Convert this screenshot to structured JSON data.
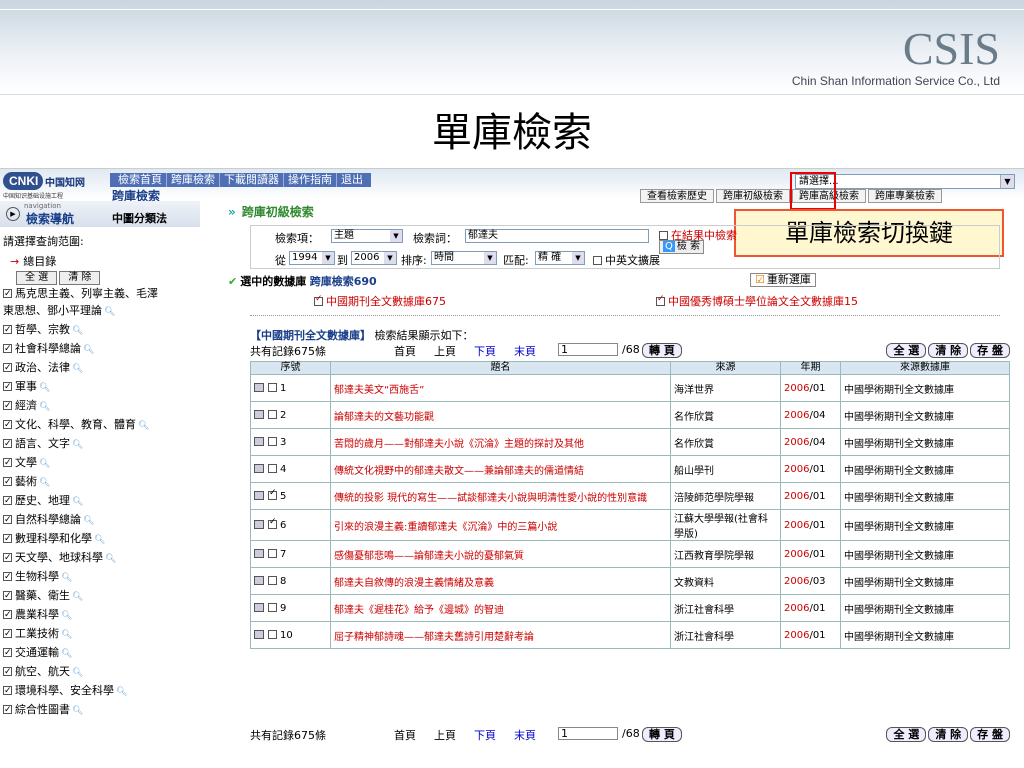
{
  "banner": {
    "brand": "CSIS",
    "company": "Chin Shan Information Service Co., Ltd"
  },
  "slide_title": "單庫檢索",
  "app": {
    "logo_cnki": "CNKI",
    "logo_zh": "中国知网",
    "logo_small": "中国知识基础设施工程",
    "topnav": [
      "檢索首頁",
      "跨庫檢索",
      "下載閱讀器",
      "操作指南",
      "退出"
    ],
    "page_sub": "跨庫檢索",
    "db_select": "請選擇...",
    "tabs": [
      "查看檢索歷史",
      "跨庫初級檢索",
      "跨庫高級檢索",
      "跨庫專業檢索"
    ],
    "callout": "單庫檢索切換鍵"
  },
  "sidebar": {
    "nav_tiny": "navigation",
    "nav_title": "檢索導航",
    "classify": "中圖分類法",
    "range_label": "請選擇查詢范圍:",
    "all_dir": "總目錄",
    "btn_all": "全 選",
    "btn_clear": "清 除",
    "categories": [
      {
        "label": "馬克思主義、列寧主義、毛澤",
        "mag": false
      },
      {
        "label": "東思想、鄧小平理論",
        "mag": true,
        "nobox": true
      },
      {
        "label": "哲學、宗教",
        "mag": true
      },
      {
        "label": "社會科學總論",
        "mag": true
      },
      {
        "label": "政治、法律",
        "mag": true
      },
      {
        "label": "軍事",
        "mag": true
      },
      {
        "label": "經濟",
        "mag": true
      },
      {
        "label": "文化、科學、教育、體育",
        "mag": true
      },
      {
        "label": "語言、文字",
        "mag": true
      },
      {
        "label": "文學",
        "mag": true
      },
      {
        "label": "藝術",
        "mag": true
      },
      {
        "label": "歷史、地理",
        "mag": true
      },
      {
        "label": "自然科學總論",
        "mag": true
      },
      {
        "label": "數理科學和化學",
        "mag": true
      },
      {
        "label": "天文學、地球科學",
        "mag": true
      },
      {
        "label": "生物科學",
        "mag": true
      },
      {
        "label": "醫藥、衛生",
        "mag": true
      },
      {
        "label": "農業科學",
        "mag": true
      },
      {
        "label": "工業技術",
        "mag": true
      },
      {
        "label": "交通運輸",
        "mag": true
      },
      {
        "label": "航空、航天",
        "mag": true
      },
      {
        "label": "環境科學、安全科學",
        "mag": true
      },
      {
        "label": "綜合性圖書",
        "mag": true
      }
    ]
  },
  "search": {
    "panel_title": "跨庫初級檢索",
    "field_label": "檢索項：",
    "field_value": "主題",
    "term_label": "檢索詞：",
    "term_value": "郁達夫",
    "in_result": "在結果中檢索",
    "search_btn": "檢 索",
    "from_label": "從",
    "year_from": "1994",
    "to_label": "到",
    "year_to": "2006",
    "sort_label": "排序:",
    "sort_value": "時間",
    "match_label": "匹配:",
    "match_value": "精 確",
    "zh_en": "中英文擴展",
    "selected_label": "選中的數據庫",
    "selected_db": "跨庫檢索690",
    "reselect": "重新選庫",
    "db1": "中國期刊全文數據庫675",
    "db2": "中國優秀博碩士學位論文全文數據庫15",
    "result_db": "【中國期刊全文數據庫】",
    "result_text": "檢索結果顯示如下："
  },
  "pager": {
    "total": "共有記錄675條",
    "first": "首頁",
    "prev": "上頁",
    "next": "下頁",
    "last": "末頁",
    "page": "1",
    "pages": "/68",
    "go": "轉 頁",
    "all": "全 選",
    "clear": "清 除",
    "save": "存 盤"
  },
  "table": {
    "headers": [
      "序號",
      "題名",
      "來源",
      "年期",
      "來源數據庫"
    ],
    "rows": [
      {
        "n": "1",
        "checked": false,
        "title": "郁達夫美文“西施舌”",
        "source": "海洋世界",
        "year": "2006",
        "issue": "/01",
        "db": "中國學術期刊全文數據庫"
      },
      {
        "n": "2",
        "checked": false,
        "title": "論郁達夫的文藝功能觀",
        "source": "名作欣賞",
        "year": "2006",
        "issue": "/04",
        "db": "中國學術期刊全文數據庫"
      },
      {
        "n": "3",
        "checked": false,
        "title": "苦悶的歲月——對郁達夫小說《沉淪》主題的探討及其他",
        "source": "名作欣賞",
        "year": "2006",
        "issue": "/04",
        "db": "中國學術期刊全文數據庫"
      },
      {
        "n": "4",
        "checked": false,
        "title": "傳統文化視野中的郁達夫散文——兼論郁達夫的儒道情結",
        "source": "船山學刊",
        "year": "2006",
        "issue": "/01",
        "db": "中國學術期刊全文數據庫"
      },
      {
        "n": "5",
        "checked": true,
        "title": "傳統的投影 現代的寫生——試談郁達夫小說與明清性愛小說的性別意識",
        "source": "涪陵師范學院學報",
        "year": "2006",
        "issue": "/01",
        "db": "中國學術期刊全文數據庫"
      },
      {
        "n": "6",
        "checked": true,
        "title": "引來的浪漫主義:重讀郁達夫《沉淪》中的三篇小說",
        "source": "江蘇大學學報(社會科學版)",
        "year": "2006",
        "issue": "/01",
        "db": "中國學術期刊全文數據庫"
      },
      {
        "n": "7",
        "checked": false,
        "title": "感傷憂郁悲鳴——論郁達夫小說的憂郁氣質",
        "source": "江西教育學院學報",
        "year": "2006",
        "issue": "/01",
        "db": "中國學術期刊全文數據庫"
      },
      {
        "n": "8",
        "checked": false,
        "title": "郁達夫自敘傳的浪漫主義情緒及意義",
        "source": "文教資料",
        "year": "2006",
        "issue": "/03",
        "db": "中國學術期刊全文數據庫"
      },
      {
        "n": "9",
        "checked": false,
        "title": "郁達夫《遲桂花》給予《邊城》的智迪",
        "source": "浙江社會科學",
        "year": "2006",
        "issue": "/01",
        "db": "中國學術期刊全文數據庫"
      },
      {
        "n": "10",
        "checked": false,
        "title": "屈子精神郁詩魂——郁達夫舊詩引用楚辭考論",
        "source": "浙江社會科學",
        "year": "2006",
        "issue": "/01",
        "db": "中國學術期刊全文數據庫"
      }
    ]
  },
  "colors": {
    "accent": "#1a3f8a",
    "highlight": "#cc0000",
    "callout_border": "#ee3311"
  }
}
